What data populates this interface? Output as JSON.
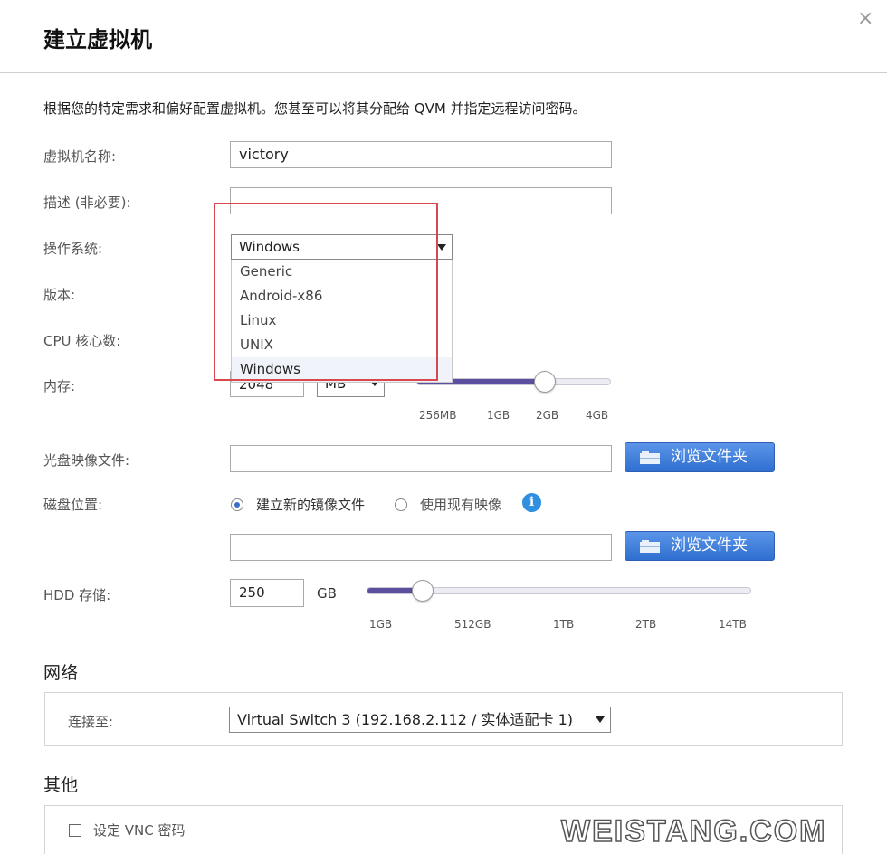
{
  "dialog": {
    "title": "建立虚拟机",
    "close_glyph": "×",
    "intro": "根据您的特定需求和偏好配置虚拟机。您甚至可以将其分配给 QVM 并指定远程访问密码。"
  },
  "form": {
    "name_label": "虚拟机名称:",
    "name_value": "victory",
    "desc_label": "描述 (非必要):",
    "desc_value": "",
    "os_label": "操作系统:",
    "os_selected": "Windows",
    "os_options": [
      "Generic",
      "Android-x86",
      "Linux",
      "UNIX",
      "Windows"
    ],
    "version_label": "版本:",
    "cpu_label": "CPU 核心数:",
    "memory_label": "内存:",
    "memory_value": "2048",
    "memory_unit": "MB",
    "memory_ticks": [
      "256MB",
      "1GB",
      "2GB",
      "4GB"
    ],
    "memory_slider_fraction": 0.66,
    "iso_label": "光盘映像文件:",
    "iso_value": "",
    "browse_label": "浏览文件夹",
    "disk_label": "磁盘位置:",
    "disk_option_new": "建立新的镜像文件",
    "disk_option_existing": "使用现有映像",
    "disk_path_value": "",
    "hdd_label": "HDD 存储:",
    "hdd_value": "250",
    "hdd_unit": "GB",
    "hdd_ticks": [
      "1GB",
      "512GB",
      "1TB",
      "2TB",
      "14TB"
    ],
    "hdd_slider_fraction": 0.147
  },
  "network": {
    "section_title": "网络",
    "connect_label": "连接至:",
    "connect_value": "Virtual Switch 3 (192.168.2.112 / 实体适配卡 1)"
  },
  "other": {
    "section_title": "其他",
    "vnc_label": "设定 VNC 密码"
  },
  "watermark": "WEISTANG.COM",
  "colors": {
    "accent": "#2f6fd0",
    "slider_fill": "#5c4fa0",
    "highlight_box": "#d8494f"
  }
}
